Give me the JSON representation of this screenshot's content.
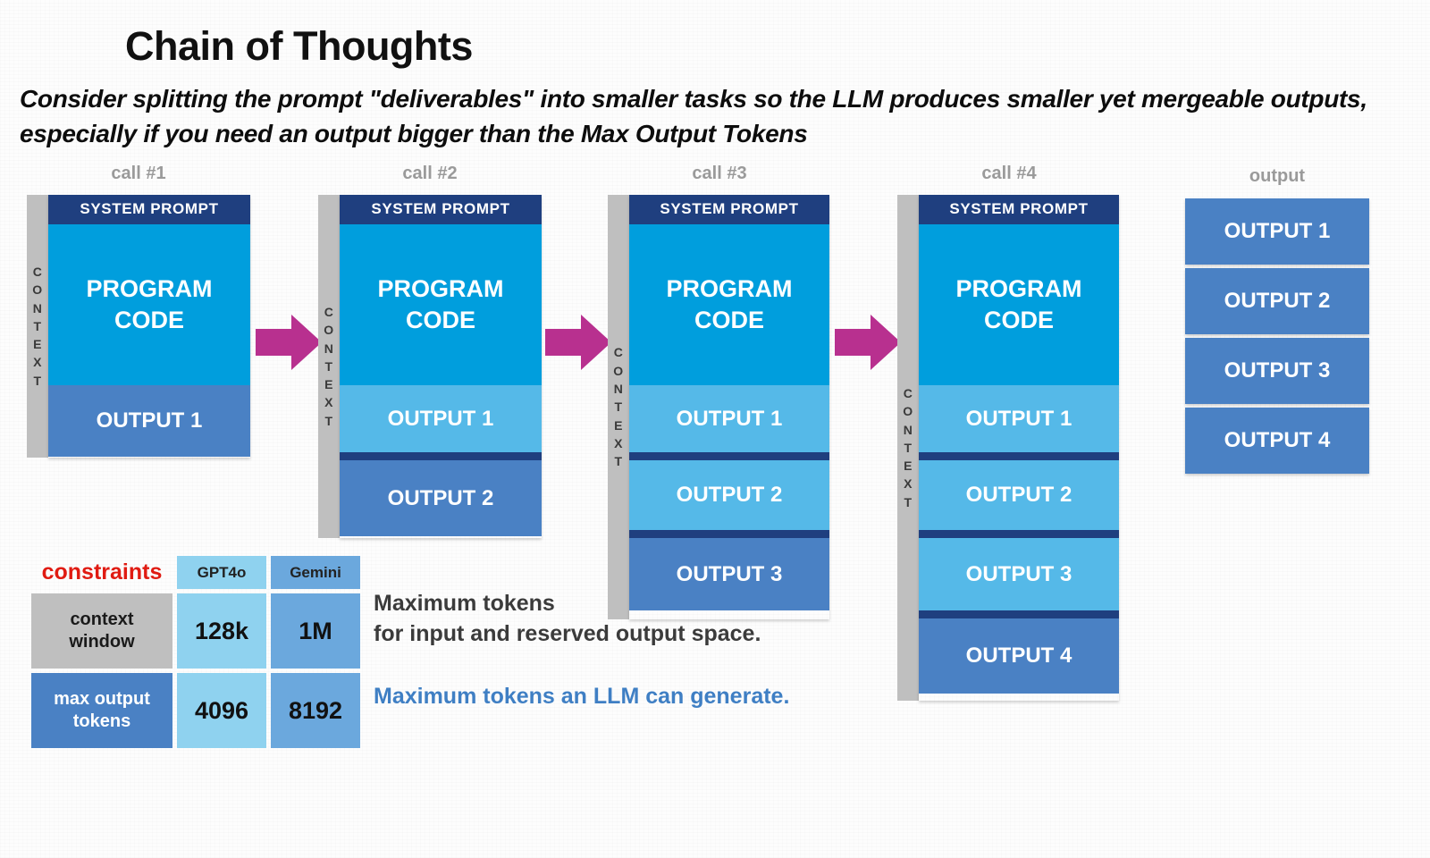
{
  "title": "Chain of Thoughts",
  "subtitle": "Consider splitting the prompt \"deliverables\" into smaller tasks so the LLM produces smaller yet mergeable outputs, especially if you need an output bigger than the Max Output Tokens",
  "context_label_letters": [
    "C",
    "O",
    "N",
    "T",
    "E",
    "X",
    "T"
  ],
  "system_prompt_label": "SYSTEM PROMPT",
  "program_code_label": "PROGRAM\nCODE",
  "calls": [
    {
      "label": "call #1",
      "outputs": [
        {
          "text": "OUTPUT 1",
          "kind": "new"
        }
      ]
    },
    {
      "label": "call #2",
      "outputs": [
        {
          "text": "OUTPUT 1",
          "kind": "context"
        },
        {
          "text": "OUTPUT 2",
          "kind": "new"
        }
      ]
    },
    {
      "label": "call #3",
      "outputs": [
        {
          "text": "OUTPUT 1",
          "kind": "context"
        },
        {
          "text": "OUTPUT 2",
          "kind": "context"
        },
        {
          "text": "OUTPUT 3",
          "kind": "new"
        }
      ]
    },
    {
      "label": "call #4",
      "outputs": [
        {
          "text": "OUTPUT 1",
          "kind": "context"
        },
        {
          "text": "OUTPUT 2",
          "kind": "context"
        },
        {
          "text": "OUTPUT 3",
          "kind": "context"
        },
        {
          "text": "OUTPUT 4",
          "kind": "new"
        }
      ]
    }
  ],
  "output_column": {
    "label": "output",
    "items": [
      "OUTPUT 1",
      "OUTPUT 2",
      "OUTPUT 3",
      "OUTPUT 4"
    ]
  },
  "constraints": {
    "title": "constraints",
    "columns": [
      "GPT4o",
      "Gemini"
    ],
    "rows": [
      {
        "label": "context\nwindow",
        "values": [
          "128k",
          "1M"
        ]
      },
      {
        "label": "max output\ntokens",
        "values": [
          "4096",
          "8192"
        ]
      }
    ]
  },
  "annotations": [
    "Maximum tokens\nfor input and reserved output space.",
    "Maximum tokens an LLM can generate."
  ],
  "colors": {
    "system_prompt": "#1f3f7f",
    "program_code": "#009edd",
    "output_context": "#55b9e8",
    "output_new": "#4a81c4",
    "context_bar": "#bfbfbf",
    "arrow": "#b8308f",
    "constraints_title": "#e01b12",
    "annotation_blue": "#3f7fc4",
    "call_label": "#9a9a9a",
    "header_gpt4o": "#8fd2ef",
    "header_gemini": "#6ba8dd"
  },
  "icons": {
    "arrow": "right-arrow-icon"
  }
}
